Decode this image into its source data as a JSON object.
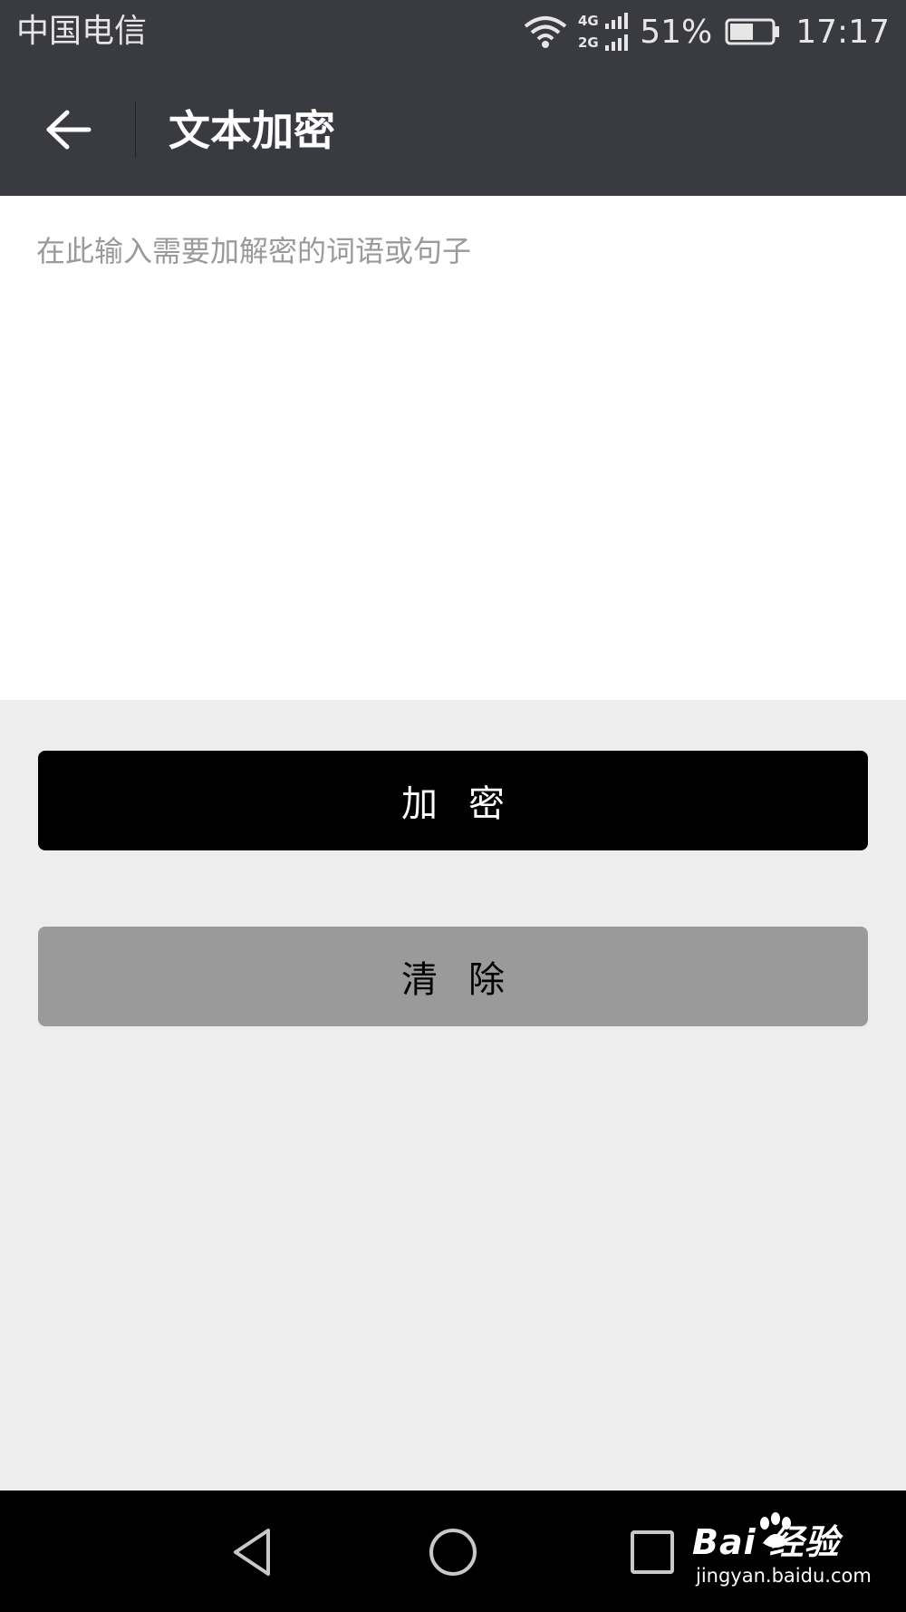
{
  "status_bar": {
    "carrier": "中国电信",
    "network_type_top": "4G",
    "network_type_bottom": "2G",
    "battery_percent": "51%",
    "time": "17:17",
    "icons": [
      "wifi-icon",
      "signal-icon",
      "battery-icon"
    ]
  },
  "app_bar": {
    "title": "文本加密",
    "back_icon": "arrow-left-icon"
  },
  "input": {
    "value": "",
    "placeholder": "在此输入需要加解密的词语或句子"
  },
  "buttons": {
    "encrypt_label": "加密",
    "clear_label": "清除"
  },
  "nav_bar": {
    "icons": [
      "triangle-back-icon",
      "circle-home-icon",
      "square-recent-icon"
    ]
  },
  "watermark": {
    "logo": "Bai  经验",
    "url": "jingyan.baidu.com"
  },
  "colors": {
    "app_bar": "#3a3b40",
    "background": "#ededed",
    "encrypt_button": "#000000",
    "clear_button": "#9a9a9a"
  }
}
